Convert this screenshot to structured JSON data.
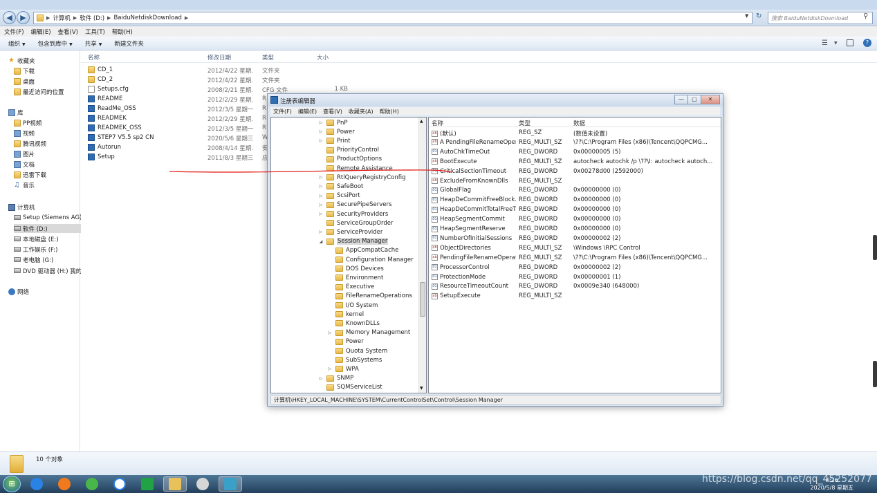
{
  "explorer": {
    "breadcrumb": [
      "计算机",
      "软件 (D:)",
      "BaiduNetdiskDownload"
    ],
    "search_placeholder": "搜索 BaiduNetdiskDownload",
    "menu": [
      "文件(F)",
      "编辑(E)",
      "查看(V)",
      "工具(T)",
      "帮助(H)"
    ],
    "toolbar": [
      "组织",
      "包含到库中",
      "共享",
      "新建文件夹"
    ],
    "columns": [
      "名称",
      "修改日期",
      "类型",
      "大小"
    ],
    "status_text": "10 个对象",
    "nav": [
      {
        "label": "收藏夹",
        "icon": "star"
      },
      {
        "label": "下载",
        "icon": "folder"
      },
      {
        "label": "桌面",
        "icon": "folder"
      },
      {
        "label": "最近访问的位置",
        "icon": "folder"
      },
      {
        "label": "库",
        "icon": "library"
      },
      {
        "label": "PP视频",
        "icon": "folder"
      },
      {
        "label": "视频",
        "icon": "library"
      },
      {
        "label": "腾讯视频",
        "icon": "folder"
      },
      {
        "label": "图片",
        "icon": "library"
      },
      {
        "label": "文档",
        "icon": "library"
      },
      {
        "label": "迅雷下载",
        "icon": "folder"
      },
      {
        "label": "音乐",
        "icon": "music"
      },
      {
        "label": "计算机",
        "icon": "computer"
      },
      {
        "label": "Setup (Siemens AG) (",
        "icon": "drive"
      },
      {
        "label": "软件 (D:)",
        "icon": "drive"
      },
      {
        "label": "本地磁盘 (E:)",
        "icon": "drive"
      },
      {
        "label": "工作娱乐 (F:)",
        "icon": "drive"
      },
      {
        "label": "老电脑 (G:)",
        "icon": "drive"
      },
      {
        "label": "DVD 驱动器 (H:) 我的",
        "icon": "drive"
      },
      {
        "label": "网络",
        "icon": "network"
      }
    ],
    "files": [
      {
        "name": "CD_1",
        "date": "2012/4/22 星期...",
        "type": "文件夹",
        "size": "",
        "icon": "folder"
      },
      {
        "name": "CD_2",
        "date": "2012/4/22 星期...",
        "type": "文件夹",
        "size": "",
        "icon": "folder"
      },
      {
        "name": "Setups.cfg",
        "date": "2008/2/21 星期...",
        "type": "CFG 文件",
        "size": "1 KB",
        "icon": "document"
      },
      {
        "name": "README",
        "date": "2012/2/29 星期...",
        "type": "R",
        "size": "",
        "icon": "app"
      },
      {
        "name": "ReadMe_OSS",
        "date": "2012/3/5 星期一...",
        "type": "R",
        "size": "",
        "icon": "app"
      },
      {
        "name": "READMEK",
        "date": "2012/2/29 星期...",
        "type": "R",
        "size": "",
        "icon": "app"
      },
      {
        "name": "READMEK_OSS",
        "date": "2012/3/5 星期一...",
        "type": "R",
        "size": "",
        "icon": "app"
      },
      {
        "name": "STEP7 V5.5 sp2 CN",
        "date": "2020/5/6 星期三...",
        "type": "W",
        "size": "",
        "icon": "app"
      },
      {
        "name": "Autorun",
        "date": "2008/4/14 星期...",
        "type": "安",
        "size": "",
        "icon": "app"
      },
      {
        "name": "Setup",
        "date": "2011/8/3 星期三...",
        "type": "应",
        "size": "",
        "icon": "app"
      }
    ]
  },
  "regedit": {
    "title": "注册表编辑器",
    "menu": [
      "文件(F)",
      "编辑(E)",
      "查看(V)",
      "收藏夹(A)",
      "帮助(H)"
    ],
    "tree": [
      {
        "label": "PnP",
        "level": 0,
        "expander": "▷"
      },
      {
        "label": "Power",
        "level": 0,
        "expander": "▷"
      },
      {
        "label": "Print",
        "level": 0,
        "expander": "▷"
      },
      {
        "label": "PriorityControl",
        "level": 0,
        "expander": ""
      },
      {
        "label": "ProductOptions",
        "level": 0,
        "expander": ""
      },
      {
        "label": "Remote Assistance",
        "level": 0,
        "expander": ""
      },
      {
        "label": "RtlQueryRegistryConfig",
        "level": 0,
        "expander": "▷"
      },
      {
        "label": "SafeBoot",
        "level": 0,
        "expander": "▷"
      },
      {
        "label": "ScsiPort",
        "level": 0,
        "expander": "▷"
      },
      {
        "label": "SecurePipeServers",
        "level": 0,
        "expander": "▷"
      },
      {
        "label": "SecurityProviders",
        "level": 0,
        "expander": "▷"
      },
      {
        "label": "ServiceGroupOrder",
        "level": 0,
        "expander": ""
      },
      {
        "label": "ServiceProvider",
        "level": 0,
        "expander": "▷"
      },
      {
        "label": "Session Manager",
        "level": 0,
        "expander": "◢",
        "selected": true
      },
      {
        "label": "AppCompatCache",
        "level": 1,
        "expander": ""
      },
      {
        "label": "Configuration Manager",
        "level": 1,
        "expander": ""
      },
      {
        "label": "DOS Devices",
        "level": 1,
        "expander": ""
      },
      {
        "label": "Environment",
        "level": 1,
        "expander": ""
      },
      {
        "label": "Executive",
        "level": 1,
        "expander": ""
      },
      {
        "label": "FileRenameOperations",
        "level": 1,
        "expander": ""
      },
      {
        "label": "I/O System",
        "level": 1,
        "expander": ""
      },
      {
        "label": "kernel",
        "level": 1,
        "expander": ""
      },
      {
        "label": "KnownDLLs",
        "level": 1,
        "expander": ""
      },
      {
        "label": "Memory Management",
        "level": 1,
        "expander": "▷"
      },
      {
        "label": "Power",
        "level": 1,
        "expander": ""
      },
      {
        "label": "Quota System",
        "level": 1,
        "expander": ""
      },
      {
        "label": "SubSystems",
        "level": 1,
        "expander": ""
      },
      {
        "label": "WPA",
        "level": 1,
        "expander": "▷"
      },
      {
        "label": "SNMP",
        "level": 0,
        "expander": "▷"
      },
      {
        "label": "SQMServiceList",
        "level": 0,
        "expander": ""
      }
    ],
    "value_columns": [
      "名称",
      "类型",
      "数据"
    ],
    "values": [
      {
        "name": "(默认)",
        "type": "REG_SZ",
        "data": "(数值未设置)",
        "icon": "ab"
      },
      {
        "name": "A PendingFileRenameOper...",
        "type": "REG_MULTI_SZ",
        "data": "\\??\\C:\\Program Files (x86)\\Tencent\\QQPCMG...",
        "icon": "ab"
      },
      {
        "name": "AutoChkTimeOut",
        "type": "REG_DWORD",
        "data": "0x00000005 (5)",
        "icon": "bin"
      },
      {
        "name": "BootExecute",
        "type": "REG_MULTI_SZ",
        "data": "autocheck autochk /p \\??\\I: autocheck autoch...",
        "icon": "ab"
      },
      {
        "name": "CriticalSectionTimeout",
        "type": "REG_DWORD",
        "data": "0x00278d00 (2592000)",
        "icon": "bin"
      },
      {
        "name": "ExcludeFromKnownDlls",
        "type": "REG_MULTI_SZ",
        "data": "",
        "icon": "ab"
      },
      {
        "name": "GlobalFlag",
        "type": "REG_DWORD",
        "data": "0x00000000 (0)",
        "icon": "bin"
      },
      {
        "name": "HeapDeCommitFreeBlock...",
        "type": "REG_DWORD",
        "data": "0x00000000 (0)",
        "icon": "bin"
      },
      {
        "name": "HeapDeCommitTotalFreeT...",
        "type": "REG_DWORD",
        "data": "0x00000000 (0)",
        "icon": "bin"
      },
      {
        "name": "HeapSegmentCommit",
        "type": "REG_DWORD",
        "data": "0x00000000 (0)",
        "icon": "bin"
      },
      {
        "name": "HeapSegmentReserve",
        "type": "REG_DWORD",
        "data": "0x00000000 (0)",
        "icon": "bin"
      },
      {
        "name": "NumberOfInitialSessions",
        "type": "REG_DWORD",
        "data": "0x00000002 (2)",
        "icon": "bin"
      },
      {
        "name": "ObjectDirectories",
        "type": "REG_MULTI_SZ",
        "data": "\\Windows \\RPC Control",
        "icon": "ab"
      },
      {
        "name": "PendingFileRenameOperat...",
        "type": "REG_MULTI_SZ",
        "data": "\\??\\C:\\Program Files (x86)\\Tencent\\QQPCMG...",
        "icon": "ab"
      },
      {
        "name": "ProcessorControl",
        "type": "REG_DWORD",
        "data": "0x00000002 (2)",
        "icon": "bin"
      },
      {
        "name": "ProtectionMode",
        "type": "REG_DWORD",
        "data": "0x00000001 (1)",
        "icon": "bin"
      },
      {
        "name": "ResourceTimeoutCount",
        "type": "REG_DWORD",
        "data": "0x0009e340 (648000)",
        "icon": "bin"
      },
      {
        "name": "SetupExecute",
        "type": "REG_MULTI_SZ",
        "data": "",
        "icon": "ab"
      }
    ],
    "status_path": "计算机\\HKEY_LOCAL_MACHINE\\SYSTEM\\CurrentControlSet\\Control\\Session Manager",
    "annotation_color": "#e0201b"
  },
  "taskbar": {
    "clock_time": "4:26",
    "clock_date": "2020/5/8 星期五",
    "watermark": "https://blog.csdn.net/qq_45252077"
  }
}
